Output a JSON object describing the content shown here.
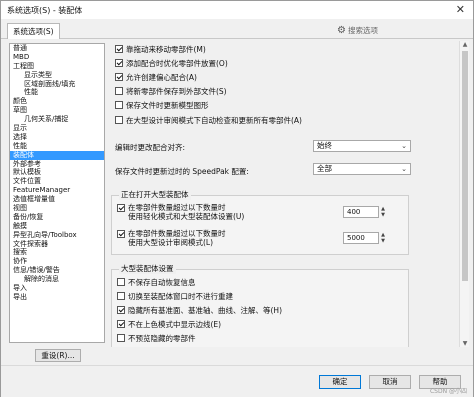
{
  "window": {
    "title": "系统选项(S) - 装配体",
    "close": "✕"
  },
  "tab": {
    "label": "系统选项(S)"
  },
  "search": {
    "icon": "gear-icon",
    "placeholder": "搜索选项"
  },
  "tree": [
    {
      "label": "普通",
      "child": false
    },
    {
      "label": "MBD",
      "child": false
    },
    {
      "label": "工程图",
      "child": false
    },
    {
      "label": "显示类型",
      "child": true
    },
    {
      "label": "区域剖面线/填充",
      "child": true
    },
    {
      "label": "性能",
      "child": true
    },
    {
      "label": "颜色",
      "child": false
    },
    {
      "label": "草图",
      "child": false
    },
    {
      "label": "几何关系/捕捉",
      "child": true
    },
    {
      "label": "显示",
      "child": false
    },
    {
      "label": "选择",
      "child": false
    },
    {
      "label": "性能",
      "child": false
    },
    {
      "label": "装配体",
      "child": false,
      "selected": true
    },
    {
      "label": "外部参考",
      "child": false
    },
    {
      "label": "默认模板",
      "child": false
    },
    {
      "label": "文件位置",
      "child": false
    },
    {
      "label": "FeatureManager",
      "child": false
    },
    {
      "label": "选值框增量值",
      "child": false
    },
    {
      "label": "视图",
      "child": false
    },
    {
      "label": "备份/恢复",
      "child": false
    },
    {
      "label": "触摸",
      "child": false
    },
    {
      "label": "异型孔向导/Toolbox",
      "child": false
    },
    {
      "label": "文件探索器",
      "child": false
    },
    {
      "label": "搜索",
      "child": false
    },
    {
      "label": "协作",
      "child": false
    },
    {
      "label": "信息/错误/警告",
      "child": false
    },
    {
      "label": "解除的消息",
      "child": true
    },
    {
      "label": "导入",
      "child": false
    },
    {
      "label": "导出",
      "child": false
    }
  ],
  "reset_label": "重设(R)...",
  "top_checks": [
    {
      "label": "靠拖动来移动零部件(M)",
      "checked": true
    },
    {
      "label": "添加配合时优化零部件放置(O)",
      "checked": true
    },
    {
      "label": "允许创建偏心配合(A)",
      "checked": true
    },
    {
      "label": "将新零部件保存到外部文件(S)",
      "checked": false
    },
    {
      "label": "保存文件时更新模型图形",
      "checked": false
    },
    {
      "label": "在大型设计审阅模式下自动检查和更新所有零部件(A)",
      "checked": false
    }
  ],
  "edit_align": {
    "label": "编辑时更改配合对齐:",
    "value": "始终"
  },
  "speedpak": {
    "label": "保存文件时更新过时的 SpeedPak 配置:",
    "value": "全部"
  },
  "open_group": {
    "title": "正在打开大型装配体",
    "rows": [
      {
        "line1": "在零部件数量超过以下数量时",
        "line2": "使用轻化模式和大型装配体设置(U)",
        "checked": true,
        "value": "400"
      },
      {
        "line1": "在零部件数量超过以下数量时",
        "line2": "使用大型设计审阅模式(L)",
        "checked": true,
        "value": "5000"
      }
    ]
  },
  "large_group": {
    "title": "大型装配体设置",
    "checks": [
      {
        "label": "不保存自动恢复信息",
        "checked": false
      },
      {
        "label": "切换至装配体窗口时不进行重建",
        "checked": false
      },
      {
        "label": "隐藏所有基准面、基准轴、曲线、注解、等(H)",
        "checked": true
      },
      {
        "label": "不在上色模式中显示边线(E)",
        "checked": true
      },
      {
        "label": "不预览隐藏的零部件",
        "checked": false
      }
    ]
  },
  "buttons": {
    "ok": "确定",
    "cancel": "取消",
    "help": "帮助"
  },
  "watermark": "CSDN @小四"
}
